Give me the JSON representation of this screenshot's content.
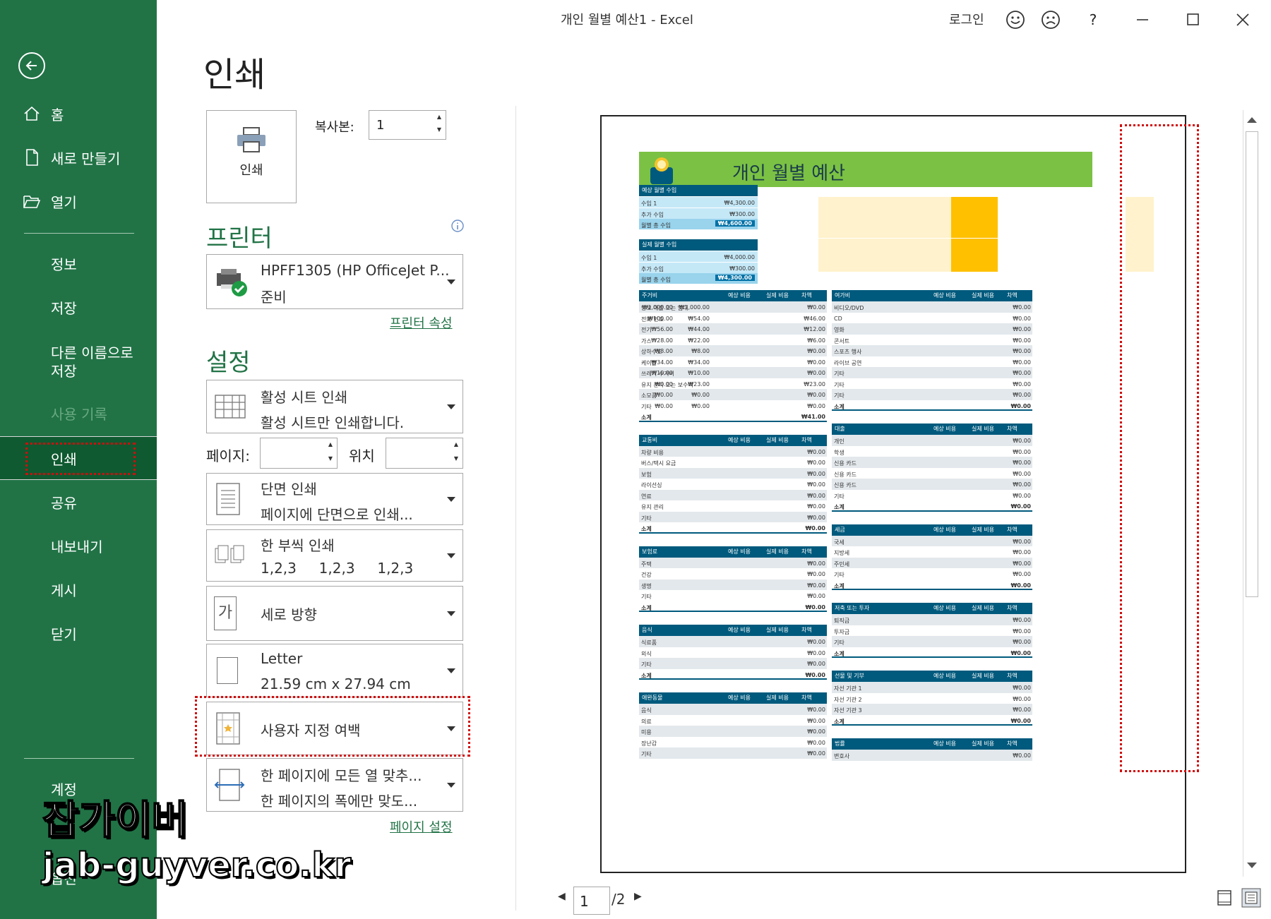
{
  "window": {
    "title": "개인 월별 예산1  -  Excel",
    "signin": "로그인",
    "help": "?"
  },
  "sidebar": {
    "home": "홈",
    "new": "새로 만들기",
    "open": "열기",
    "info": "정보",
    "save": "저장",
    "saveas_1": "다른 이름으로",
    "saveas_2": "저장",
    "history": "사용 기록",
    "print": "인쇄",
    "share": "공유",
    "export": "내보내기",
    "publish": "게시",
    "close": "닫기",
    "account": "계정",
    "options": "옵션"
  },
  "print": {
    "title": "인쇄",
    "button": "인쇄",
    "copies_label": "복사본:",
    "copies_value": "1",
    "printer_header": "프린터",
    "printer_name": "HPFF1305 (HP OfficeJet P...",
    "printer_status": "준비",
    "printer_props": "프린터 속성",
    "settings_header": "설정",
    "what_1": "활성 시트 인쇄",
    "what_2": "활성 시트만 인쇄합니다.",
    "pages_label": "페이지:",
    "to_label": "위치",
    "sides_1": "단면 인쇄",
    "sides_2": "페이지에 단면으로 인쇄...",
    "collate_1": "한 부씩 인쇄",
    "collate_2": "1,2,3     1,2,3     1,2,3",
    "orient": "세로 방향",
    "orient_icon": "가",
    "paper_1": "Letter",
    "paper_2": "21.59 cm x 27.94 cm",
    "margins": "사용자 지정 여백",
    "scale_1": "한 페이지에 모든 열 맞추...",
    "scale_2": "한 페이지의 폭에만 맞도...",
    "page_setup": "페이지 설정"
  },
  "preview": {
    "page": "1",
    "of": "/2"
  },
  "sheet": {
    "title": "개인 월별 예산",
    "col_exp": "예상 비용",
    "col_act": "실제 비용",
    "col_diff": "차액",
    "income1": {
      "header": "예상 월별 수입",
      "rows": [
        [
          "수입 1",
          "₩4,300.00"
        ],
        [
          "추가 수입",
          "₩300.00"
        ],
        [
          "월별 총 수입",
          "₩4,600.00"
        ]
      ]
    },
    "income2": {
      "header": "실제 월별 수입",
      "rows": [
        [
          "수입 1",
          "₩4,000.00"
        ],
        [
          "추가 수입",
          "₩300.00"
        ],
        [
          "월별 총 수입",
          "₩4,300.00"
        ]
      ]
    },
    "left": [
      {
        "header": "주거비",
        "rows": [
          [
            "담보 대출 또는 임대",
            "₩1,000.00",
            "₩1,000.00",
            "₩0.00"
          ],
          [
            "전화 번호",
            "₩54.00",
            "₩100.00",
            "₩46.00"
          ],
          [
            "전기",
            "₩44.00",
            "₩56.00",
            "₩12.00"
          ],
          [
            "가스",
            "₩22.00",
            "₩28.00",
            "₩6.00"
          ],
          [
            "상하수도",
            "₩8.00",
            "₩8.00",
            "₩0.00"
          ],
          [
            "케이블",
            "₩34.00",
            "₩34.00",
            "₩0.00"
          ],
          [
            "쓰레기 수거비",
            "₩10.00",
            "₩10.00",
            "₩0.00"
          ],
          [
            "유지 관리 또는 보수비",
            "₩23.00",
            "₩0.00",
            "₩23.00"
          ],
          [
            "소모품",
            "₩0.00",
            "₩0.00",
            "₩0.00"
          ],
          [
            "기타",
            "₩0.00",
            "₩0.00",
            "₩0.00"
          ]
        ],
        "total": [
          "소계",
          "",
          "",
          "₩41.00"
        ]
      },
      {
        "header": "교통비",
        "rows": [
          [
            "차량 비용",
            "",
            "",
            "₩0.00"
          ],
          [
            "버스/택시 요금",
            "",
            "",
            "₩0.00"
          ],
          [
            "보험",
            "",
            "",
            "₩0.00"
          ],
          [
            "라이선싱",
            "",
            "",
            "₩0.00"
          ],
          [
            "연료",
            "",
            "",
            "₩0.00"
          ],
          [
            "유지 관리",
            "",
            "",
            "₩0.00"
          ],
          [
            "기타",
            "",
            "",
            "₩0.00"
          ]
        ],
        "total": [
          "소계",
          "",
          "",
          "₩0.00"
        ]
      },
      {
        "header": "보험료",
        "rows": [
          [
            "주택",
            "",
            "",
            "₩0.00"
          ],
          [
            "건강",
            "",
            "",
            "₩0.00"
          ],
          [
            "생명",
            "",
            "",
            "₩0.00"
          ],
          [
            "기타",
            "",
            "",
            "₩0.00"
          ]
        ],
        "total": [
          "소계",
          "",
          "",
          "₩0.00"
        ]
      },
      {
        "header": "음식",
        "rows": [
          [
            "식료품",
            "",
            "",
            "₩0.00"
          ],
          [
            "외식",
            "",
            "",
            "₩0.00"
          ],
          [
            "기타",
            "",
            "",
            "₩0.00"
          ]
        ],
        "total": [
          "소계",
          "",
          "",
          "₩0.00"
        ]
      },
      {
        "header": "애완동물",
        "rows": [
          [
            "음식",
            "",
            "",
            "₩0.00"
          ],
          [
            "의료",
            "",
            "",
            "₩0.00"
          ],
          [
            "미용",
            "",
            "",
            "₩0.00"
          ],
          [
            "장난감",
            "",
            "",
            "₩0.00"
          ],
          [
            "기타",
            "",
            "",
            "₩0.00"
          ]
        ]
      }
    ],
    "right": [
      {
        "header": "여가비",
        "rows": [
          [
            "비디오/DVD",
            "",
            "",
            "₩0.00"
          ],
          [
            "CD",
            "",
            "",
            "₩0.00"
          ],
          [
            "영화",
            "",
            "",
            "₩0.00"
          ],
          [
            "콘서트",
            "",
            "",
            "₩0.00"
          ],
          [
            "스포츠 행사",
            "",
            "",
            "₩0.00"
          ],
          [
            "라이브 공연",
            "",
            "",
            "₩0.00"
          ],
          [
            "기타",
            "",
            "",
            "₩0.00"
          ],
          [
            "기타",
            "",
            "",
            "₩0.00"
          ],
          [
            "기타",
            "",
            "",
            "₩0.00"
          ]
        ],
        "total": [
          "소계",
          "",
          "",
          "₩0.00"
        ]
      },
      {
        "header": "대출",
        "rows": [
          [
            "개인",
            "",
            "",
            "₩0.00"
          ],
          [
            "학생",
            "",
            "",
            "₩0.00"
          ],
          [
            "신용 카드",
            "",
            "",
            "₩0.00"
          ],
          [
            "신용 카드",
            "",
            "",
            "₩0.00"
          ],
          [
            "신용 카드",
            "",
            "",
            "₩0.00"
          ],
          [
            "기타",
            "",
            "",
            "₩0.00"
          ]
        ],
        "total": [
          "소계",
          "",
          "",
          "₩0.00"
        ]
      },
      {
        "header": "세금",
        "rows": [
          [
            "국세",
            "",
            "",
            "₩0.00"
          ],
          [
            "지방세",
            "",
            "",
            "₩0.00"
          ],
          [
            "주민세",
            "",
            "",
            "₩0.00"
          ],
          [
            "기타",
            "",
            "",
            "₩0.00"
          ]
        ],
        "total": [
          "소계",
          "",
          "",
          "₩0.00"
        ]
      },
      {
        "header": "저축 또는 투자",
        "rows": [
          [
            "퇴직금",
            "",
            "",
            "₩0.00"
          ],
          [
            "투자금",
            "",
            "",
            "₩0.00"
          ],
          [
            "기타",
            "",
            "",
            "₩0.00"
          ]
        ],
        "total": [
          "소계",
          "",
          "",
          "₩0.00"
        ]
      },
      {
        "header": "선물 및 기부",
        "rows": [
          [
            "자선 기관 1",
            "",
            "",
            "₩0.00"
          ],
          [
            "자선 기관 2",
            "",
            "",
            "₩0.00"
          ],
          [
            "자선 기관 3",
            "",
            "",
            "₩0.00"
          ]
        ],
        "total": [
          "소계",
          "",
          "",
          "₩0.00"
        ]
      },
      {
        "header": "법률",
        "rows": [
          [
            "변호사",
            "",
            "",
            "₩0.00"
          ]
        ]
      }
    ]
  },
  "watermark": {
    "line1": "잡가이버",
    "line2": "jab-guyver.co.kr"
  }
}
